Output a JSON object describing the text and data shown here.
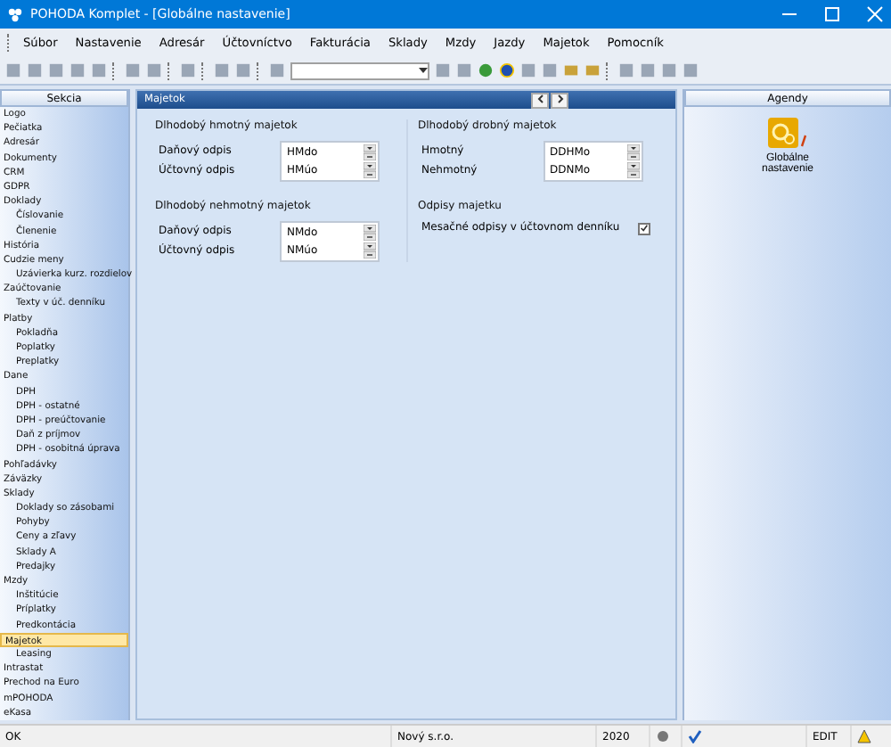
{
  "window": {
    "title": "POHODA Komplet - [Globálne nastavenie]"
  },
  "menu": [
    "Súbor",
    "Nastavenie",
    "Adresár",
    "Účtovníctvo",
    "Fakturácia",
    "Sklady",
    "Mzdy",
    "Jazdy",
    "Majetok",
    "Pomocník"
  ],
  "sidebar": {
    "header": "Sekcia",
    "items": [
      {
        "label": "Logo",
        "selected": false
      },
      {
        "label": "Pečiatka",
        "selected": false
      },
      {
        "label": "Adresár",
        "selected": false
      },
      {
        "label": "Dokumenty",
        "selected": false
      },
      {
        "label": "CRM",
        "selected": false
      },
      {
        "label": "GDPR",
        "selected": false
      },
      {
        "label": "Doklady",
        "selected": false,
        "children": [
          {
            "label": "Číslovanie",
            "selected": false
          },
          {
            "label": "Členenie",
            "selected": false
          }
        ]
      },
      {
        "label": "História",
        "selected": false
      },
      {
        "label": "Cudzie meny",
        "selected": false,
        "children": [
          {
            "label": "Uzávierka kurz. rozdielov",
            "selected": false
          }
        ]
      },
      {
        "label": "Zaúčtovanie",
        "selected": false,
        "children": [
          {
            "label": "Texty v úč. denníku",
            "selected": false
          }
        ]
      },
      {
        "label": "Platby",
        "selected": false,
        "children": [
          {
            "label": "Pokladňa",
            "selected": false
          },
          {
            "label": "Poplatky",
            "selected": false
          },
          {
            "label": "Preplatky",
            "selected": false
          }
        ]
      },
      {
        "label": "Dane",
        "selected": false,
        "children": [
          {
            "label": "DPH",
            "selected": false
          },
          {
            "label": "DPH - ostatné",
            "selected": false
          },
          {
            "label": "DPH - preúčtovanie",
            "selected": false
          },
          {
            "label": "Daň z príjmov",
            "selected": false
          },
          {
            "label": "DPH - osobitná úprava",
            "selected": false
          }
        ]
      },
      {
        "label": "Pohľadávky",
        "selected": false
      },
      {
        "label": "Záväzky",
        "selected": false
      },
      {
        "label": "Sklady",
        "selected": false,
        "children": [
          {
            "label": "Doklady so zásobami",
            "selected": false
          },
          {
            "label": "Pohyby",
            "selected": false
          },
          {
            "label": "Ceny a zľavy",
            "selected": false
          },
          {
            "label": "Sklady A",
            "selected": false
          },
          {
            "label": "Predajky",
            "selected": false
          }
        ]
      },
      {
        "label": "Mzdy",
        "selected": false,
        "children": [
          {
            "label": "Inštitúcie",
            "selected": false
          },
          {
            "label": "Príplatky",
            "selected": false
          },
          {
            "label": "Predkontácia",
            "selected": false
          }
        ]
      },
      {
        "label": "Majetok",
        "selected": true,
        "children": [
          {
            "label": "Leasing",
            "selected": false
          }
        ]
      },
      {
        "label": "Intrastat",
        "selected": false
      },
      {
        "label": "Prechod na Euro",
        "selected": false
      },
      {
        "label": "mPOHODA",
        "selected": false
      },
      {
        "label": "eKasa",
        "selected": false
      }
    ]
  },
  "panel": {
    "title": "Majetok",
    "columns": [
      [
        {
          "title": "Dlhodobý hmotný majetok",
          "rows": [
            {
              "label": "Daňový odpis",
              "value": "HMdo"
            },
            {
              "label": "Účtovný odpis",
              "value": "HMúo"
            }
          ]
        },
        {
          "title": "Dlhodobý nehmotný majetok",
          "rows": [
            {
              "label": "Daňový odpis",
              "value": "NMdo"
            },
            {
              "label": "Účtovný odpis",
              "value": "NMúo"
            }
          ]
        }
      ],
      [
        {
          "title": "Dlhodobý drobný majetok",
          "rows": [
            {
              "label": "Hmotný",
              "value": "DDHMo"
            },
            {
              "label": "Nehmotný",
              "value": "DDNMo"
            }
          ]
        },
        {
          "title": "Odpisy majetku",
          "checks": [
            {
              "label": "Mesačné odpisy v účtovnom denníku",
              "checked": true
            }
          ]
        }
      ]
    ]
  },
  "agendas": {
    "header": "Agendy",
    "items": [
      {
        "label": "Globálne nastavenie"
      }
    ]
  },
  "status_bar": {
    "message": "OK",
    "company": "Nový s.r.o.",
    "year": "2020",
    "mode": "EDIT"
  }
}
